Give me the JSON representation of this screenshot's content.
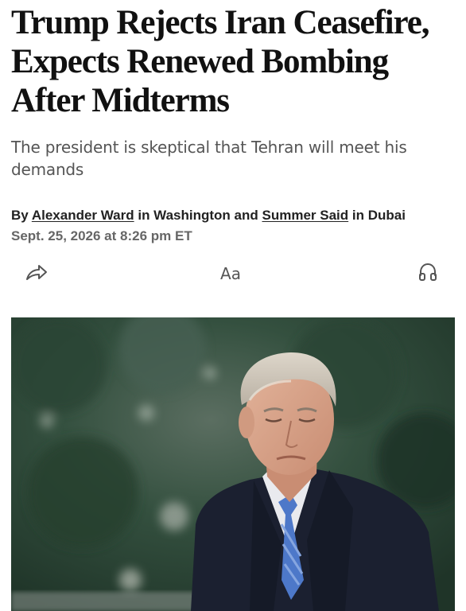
{
  "article": {
    "headline": "Trump Rejects Iran Ceasefire, Expects Renewed Bombing After Midterms",
    "dek": "The president is skeptical that Tehran will meet his demands",
    "byline": {
      "prefix": "By ",
      "author1": "Alexander Ward",
      "middle1": " in Washington and ",
      "author2": "Summer Said",
      "suffix": " in Dubai"
    },
    "timestamp": "Sept. 25, 2026 at 8:26 pm ET"
  },
  "toolbar": {
    "share_icon": "share-arrow-icon",
    "text_size_label": "Aa",
    "listen_icon": "headphones-icon"
  },
  "photo": {
    "subject": "news-photo",
    "colors": {
      "background": "#2f4a3a",
      "coat": "#1b2030",
      "tie": "#4d78c9",
      "hair": "#cfc7bb"
    }
  }
}
